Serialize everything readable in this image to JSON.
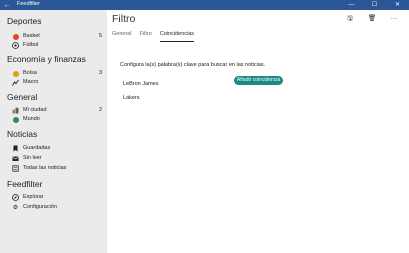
{
  "window": {
    "title": "Feedfilter",
    "back": "←",
    "minimize": "—",
    "maximize": "☐",
    "close": "✕"
  },
  "sidebar": {
    "sections": [
      {
        "title": "Deportes",
        "items": [
          {
            "label": "Basket",
            "count": "5",
            "icon": "basketball-icon",
            "color": "#e04a1a"
          },
          {
            "label": "Fútbol",
            "count": "",
            "icon": "soccer-icon"
          }
        ]
      },
      {
        "title": "Economía y finanzas",
        "items": [
          {
            "label": "Bolsa",
            "count": "3",
            "icon": "moneybag-icon",
            "color": "#d9a21b"
          },
          {
            "label": "Macro",
            "count": "",
            "icon": "chart-icon"
          }
        ]
      },
      {
        "title": "General",
        "items": [
          {
            "label": "Mi ciudad",
            "count": "2",
            "icon": "city-icon"
          },
          {
            "label": "Mundo",
            "count": "",
            "icon": "globe-icon",
            "color": "#2e8b57"
          }
        ]
      },
      {
        "title": "Noticias",
        "items": [
          {
            "label": "Guardadas",
            "icon": "bookmark-icon"
          },
          {
            "label": "Sin leer",
            "icon": "envelope-icon"
          },
          {
            "label": "Todas las noticias",
            "icon": "list-icon"
          }
        ]
      },
      {
        "title": "Feedfilter",
        "items": [
          {
            "label": "Explorar",
            "icon": "explore-icon"
          },
          {
            "label": "Configuración",
            "icon": "gear-icon"
          }
        ]
      }
    ]
  },
  "main": {
    "title": "Filtro",
    "actions": {
      "save": "🖫",
      "delete": "🗑",
      "more": "···"
    },
    "tabs": [
      "General",
      "Filtro",
      "Coincidencias"
    ],
    "active_tab": "Coincidencias",
    "prompt": "Configura la(s) palabra(s) clave para buscar en las noticias.",
    "add_button": "Añadir coincidencia",
    "keywords": [
      "LeBron James",
      "Lakers"
    ]
  }
}
